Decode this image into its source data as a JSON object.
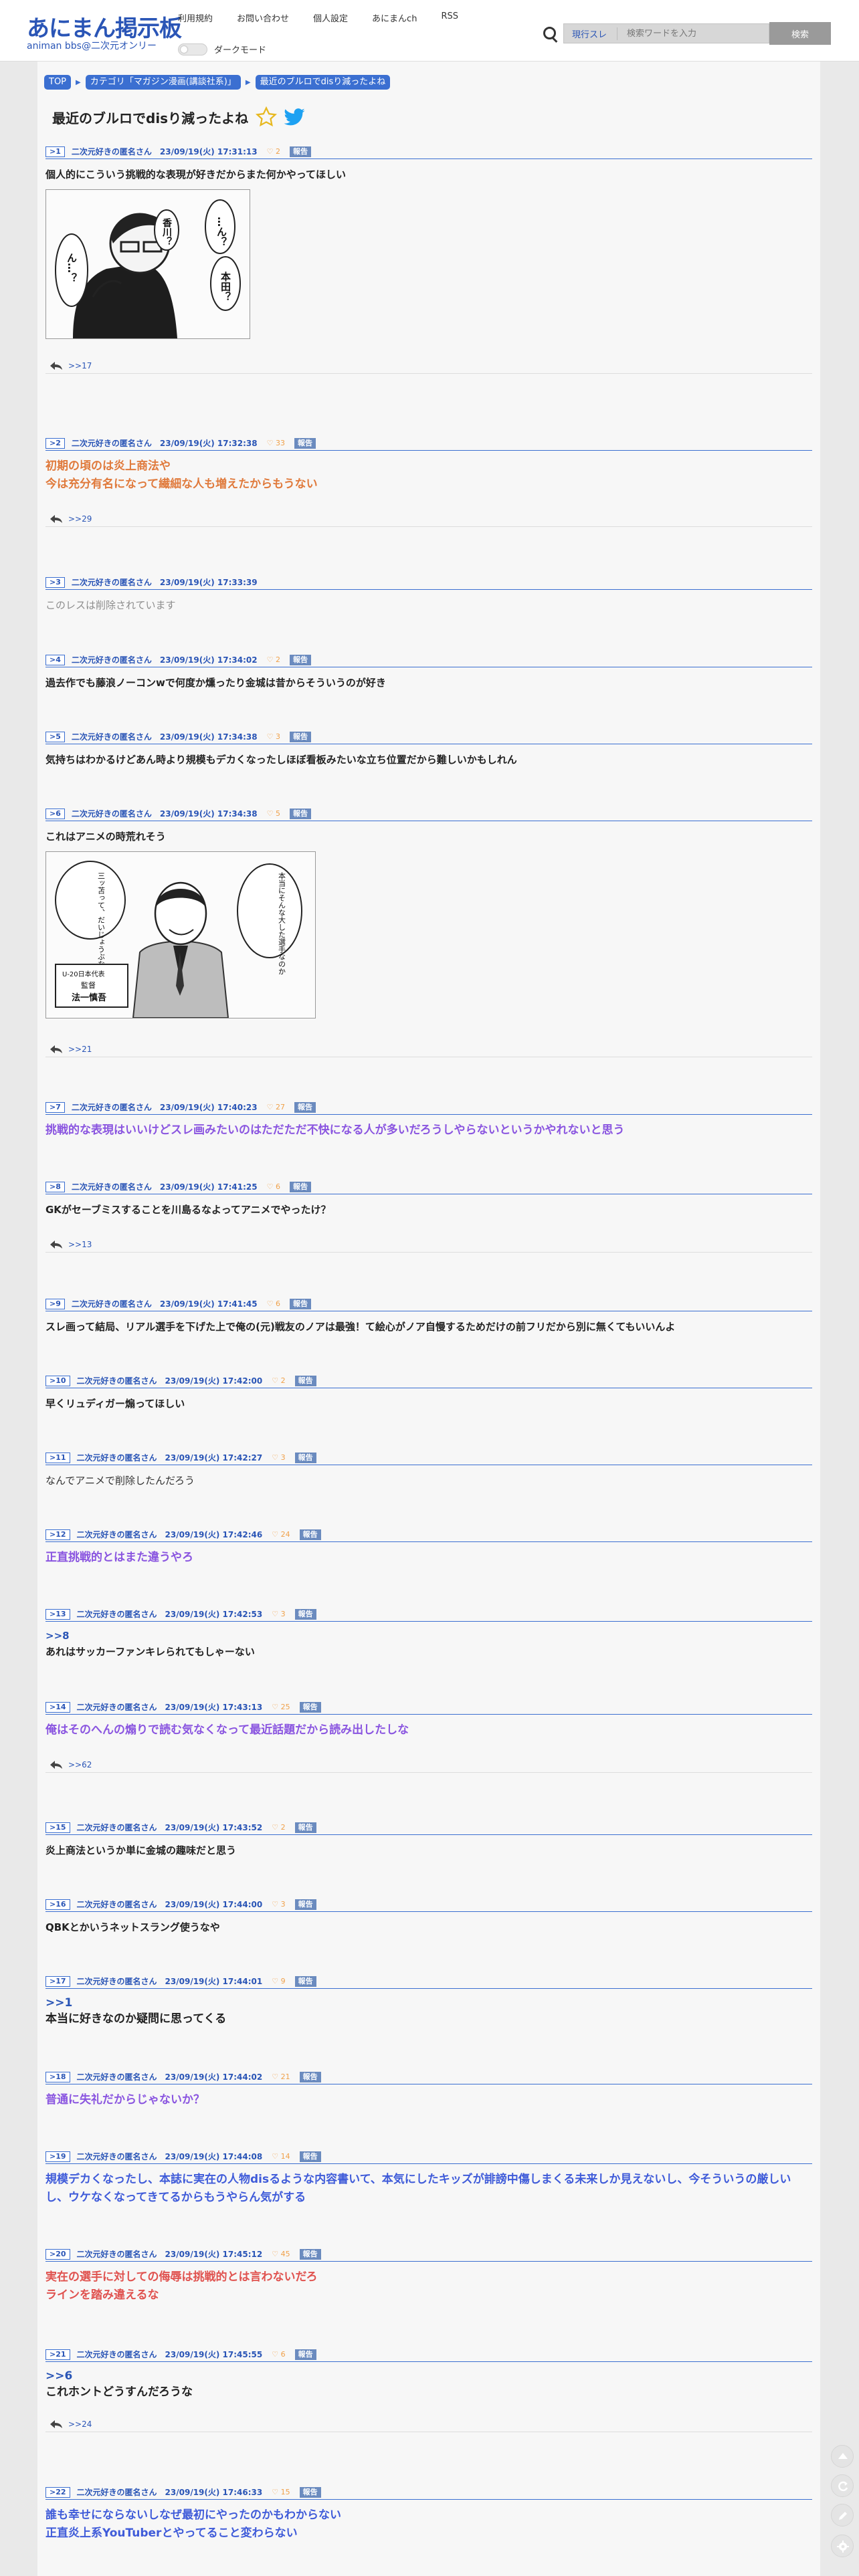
{
  "header": {
    "logo_main": "あにまん掲示板",
    "logo_sub": "animan bbs@二次元オンリー",
    "nav": [
      "利用規約",
      "お問い合わせ",
      "個人設定",
      "あにまんch",
      "RSS"
    ],
    "dark_mode_label": "ダークモード",
    "search_select": "現行スレ",
    "search_placeholder": "検索ワードを入力",
    "search_button": "検索"
  },
  "breadcrumb": [
    "TOP",
    "カテゴリ「マガジン漫画(講談社系)」",
    "最近のブルロでdisり減ったよね"
  ],
  "thread": {
    "title": "最近のブルロでdisり減ったよね"
  },
  "posts": [
    {
      "num": ">1",
      "name": "二次元好きの匿名さん",
      "date": "23/09/19(火) 17:31:13",
      "likes": "2",
      "report": "報告",
      "body": "個人的にこういう挑戦的な表現が好きだからまた何かやってほしい",
      "reply": ">>17"
    },
    {
      "num": ">2",
      "name": "二次元好きの匿名さん",
      "date": "23/09/19(火) 17:32:38",
      "likes": "33",
      "report": "報告",
      "body": "初期の頃のは炎上商法や\n今は充分有名になって繊細な人も増えたからもうない",
      "reply": ">>29"
    },
    {
      "num": ">3",
      "name": "二次元好きの匿名さん",
      "date": "23/09/19(火) 17:33:39",
      "body": "このレスは削除されています"
    },
    {
      "num": ">4",
      "name": "二次元好きの匿名さん",
      "date": "23/09/19(火) 17:34:02",
      "likes": "2",
      "report": "報告",
      "body": "過去作でも藤浪ノーコンwで何度か燻ったり金城は昔からそういうのが好き"
    },
    {
      "num": ">5",
      "name": "二次元好きの匿名さん",
      "date": "23/09/19(火) 17:34:38",
      "likes": "3",
      "report": "報告",
      "body": "気持ちはわかるけどあん時より規模もデカくなったしほぼ看板みたいな立ち位置だから難しいかもしれん"
    },
    {
      "num": ">6",
      "name": "二次元好きの匿名さん",
      "date": "23/09/19(火) 17:34:38",
      "likes": "5",
      "report": "報告",
      "body": "これはアニメの時荒れそう",
      "reply": ">>21"
    },
    {
      "num": ">7",
      "name": "二次元好きの匿名さん",
      "date": "23/09/19(火) 17:40:23",
      "likes": "27",
      "report": "報告",
      "body": "挑戦的な表現はいいけどスレ画みたいのはただただ不快になる人が多いだろうしやらないというかやれないと思う"
    },
    {
      "num": ">8",
      "name": "二次元好きの匿名さん",
      "date": "23/09/19(火) 17:41:25",
      "likes": "6",
      "report": "報告",
      "body": "GKがセーブミスすることを川島るなよってアニメでやったけ？",
      "reply": ">>13"
    },
    {
      "num": ">9",
      "name": "二次元好きの匿名さん",
      "date": "23/09/19(火) 17:41:45",
      "likes": "6",
      "report": "報告",
      "body": "スレ画って結局、リアル選手を下げた上で俺の(元)戦友のノアは最強！て絵心がノア自慢するためだけの前フリだから別に無くてもいいんよ"
    },
    {
      "num": ">10",
      "name": "二次元好きの匿名さん",
      "date": "23/09/19(火) 17:42:00",
      "likes": "2",
      "report": "報告",
      "body": "早くリュディガー煽ってほしい"
    },
    {
      "num": ">11",
      "name": "二次元好きの匿名さん",
      "date": "23/09/19(火) 17:42:27",
      "likes": "3",
      "report": "報告",
      "body": "なんでアニメで削除したんだろう"
    },
    {
      "num": ">12",
      "name": "二次元好きの匿名さん",
      "date": "23/09/19(火) 17:42:46",
      "likes": "24",
      "report": "報告",
      "body": "正直挑戦的とはまた違うやろ"
    },
    {
      "num": ">13",
      "name": "二次元好きの匿名さん",
      "date": "23/09/19(火) 17:42:53",
      "likes": "3",
      "report": "報告",
      "anchor": ">>8",
      "body": "あれはサッカーファンキレられてもしゃーない"
    },
    {
      "num": ">14",
      "name": "二次元好きの匿名さん",
      "date": "23/09/19(火) 17:43:13",
      "likes": "25",
      "report": "報告",
      "body": "俺はそのへんの煽りで読む気なくなって最近話題だから読み出したしな",
      "reply": ">>62"
    },
    {
      "num": ">15",
      "name": "二次元好きの匿名さん",
      "date": "23/09/19(火) 17:43:52",
      "likes": "2",
      "report": "報告",
      "body": "炎上商法というか単に金城の趣味だと思う"
    },
    {
      "num": ">16",
      "name": "二次元好きの匿名さん",
      "date": "23/09/19(火) 17:44:00",
      "likes": "3",
      "report": "報告",
      "body": "QBKとかいうネットスラング使うなや"
    },
    {
      "num": ">17",
      "name": "二次元好きの匿名さん",
      "date": "23/09/19(火) 17:44:01",
      "likes": "9",
      "report": "報告",
      "anchor": ">>1",
      "body": "本当に好きなのか疑問に思ってくる"
    },
    {
      "num": ">18",
      "name": "二次元好きの匿名さん",
      "date": "23/09/19(火) 17:44:02",
      "likes": "21",
      "report": "報告",
      "body": "普通に失礼だからじゃないか？"
    },
    {
      "num": ">19",
      "name": "二次元好きの匿名さん",
      "date": "23/09/19(火) 17:44:08",
      "likes": "14",
      "report": "報告",
      "body": "規模デカくなったし、本誌に実在の人物disるような内容書いて、本気にしたキッズが誹謗中傷しまくる未来しか見えないし、今そういうの厳しいし、ウケなくなってきてるからもうやらん気がする"
    },
    {
      "num": ">20",
      "name": "二次元好きの匿名さん",
      "date": "23/09/19(火) 17:45:12",
      "likes": "45",
      "report": "報告",
      "body": "実在の選手に対しての侮辱は挑戦的とは言わないだろ\nラインを踏み違えるな"
    },
    {
      "num": ">21",
      "name": "二次元好きの匿名さん",
      "date": "23/09/19(火) 17:45:55",
      "likes": "6",
      "report": "報告",
      "anchor": ">>6",
      "body": "これホントどうすんだろうな",
      "reply": ">>24"
    },
    {
      "num": ">22",
      "name": "二次元好きの匿名さん",
      "date": "23/09/19(火) 17:46:33",
      "likes": "15",
      "report": "報告",
      "body": "誰も幸せにならないしなぜ最初にやったのかもわからない\n正直炎上系YouTuberとやってること変わらない"
    }
  ],
  "images": {
    "post1_bubbles": [
      "…ん？",
      "香川？",
      "本田？",
      "ん…？"
    ],
    "post6_left_bubble": "三ッ苫って、だいじょうぶなのか？",
    "post6_right_bubble": "本当にそんな大した選手なのか",
    "post6_caption_1": "U-20日本代表",
    "post6_caption_2": "監督",
    "post6_caption_3": "法一慎吾"
  },
  "colors": {
    "accent": "#2a55b6",
    "crumb": "#3b6fd1",
    "like": "#f0a14a",
    "purple": "#8a55e0",
    "orange": "#e07a3c",
    "red": "#e0524f"
  }
}
